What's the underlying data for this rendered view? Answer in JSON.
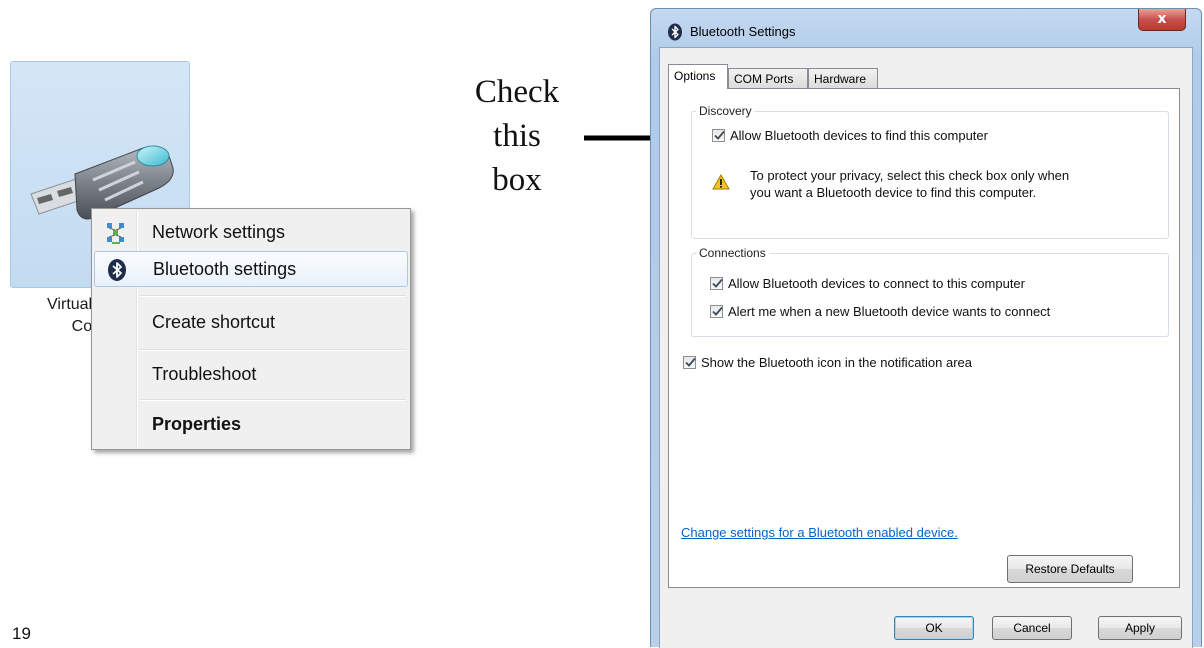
{
  "device_tile": {
    "label_line1": "Virtual I",
    "label_line2": "Con",
    "icon": "usb-dongle-icon"
  },
  "context_menu": {
    "items": [
      {
        "label": "Network settings",
        "icon": "network-icon"
      },
      {
        "label": "Bluetooth settings",
        "icon": "bluetooth-icon",
        "highlighted": true
      },
      {
        "label": "Create shortcut"
      },
      {
        "label": "Troubleshoot"
      },
      {
        "label": "Properties",
        "bold": true
      }
    ]
  },
  "annotation": {
    "line1": "Check",
    "line2": "this",
    "line3": "box",
    "arrow": "arrow-right-icon"
  },
  "page_number": "19",
  "dialog": {
    "title": "Bluetooth Settings",
    "close_label": "x",
    "tabs": [
      {
        "label": "Options",
        "active": true
      },
      {
        "label": "COM Ports"
      },
      {
        "label": "Hardware"
      }
    ],
    "discovery": {
      "title": "Discovery",
      "allow_find": {
        "label": "Allow Bluetooth devices to find this computer",
        "checked": true
      },
      "warning_line1": "To protect your privacy, select this check box only when",
      "warning_line2": "you want a Bluetooth device to find this computer."
    },
    "connections": {
      "title": "Connections",
      "allow_connect": {
        "label": "Allow Bluetooth devices to connect to this computer",
        "checked": true
      },
      "alert_new": {
        "label": "Alert me when a new Bluetooth device wants to connect",
        "checked": true
      }
    },
    "show_icon": {
      "label": "Show the Bluetooth icon in the notification area",
      "checked": true
    },
    "change_link": "Change settings for a Bluetooth enabled device.",
    "restore_defaults": "Restore Defaults",
    "ok": "OK",
    "cancel": "Cancel",
    "apply": "Apply"
  },
  "colors": {
    "accent": "#0066cc",
    "dialog_frame": "#b8d0ea",
    "close_button": "#c75050"
  }
}
